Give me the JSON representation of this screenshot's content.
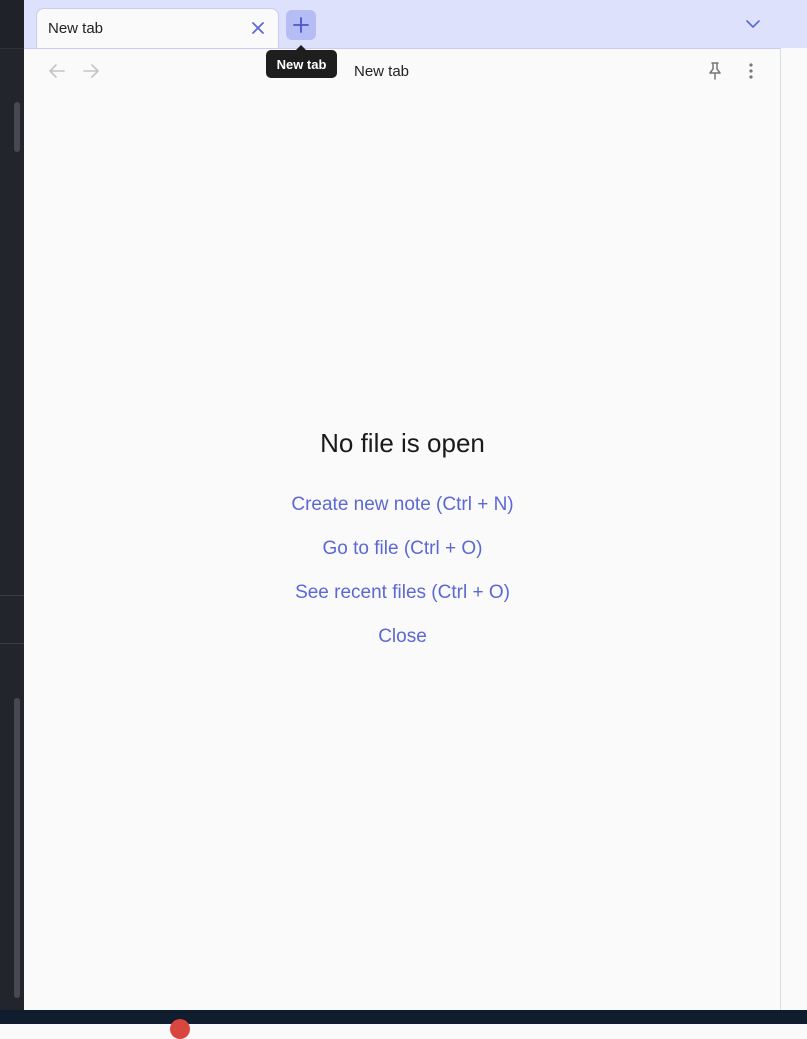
{
  "tabs": [
    {
      "title": "New tab",
      "active": true
    }
  ],
  "tooltip": {
    "text": "New tab"
  },
  "header": {
    "title": "New tab"
  },
  "empty_state": {
    "title": "No file is open",
    "actions": [
      {
        "label": "Create new note (Ctrl + N)"
      },
      {
        "label": "Go to file (Ctrl + O)"
      },
      {
        "label": "See recent files (Ctrl + O)"
      },
      {
        "label": "Close"
      }
    ]
  },
  "icons": {
    "close_tab": "close-icon",
    "new_tab": "plus-icon",
    "tab_list": "chevron-down-icon",
    "back": "arrow-left-icon",
    "forward": "arrow-right-icon",
    "pin": "pin-icon",
    "more": "more-vertical-icon"
  },
  "colors": {
    "accent": "#5c68d3",
    "tabbar_bg": "#dde1fb",
    "new_tab_bg": "#b6bdf5",
    "sidebar_bg": "#22252b",
    "tooltip_bg": "#1e1e1e"
  }
}
